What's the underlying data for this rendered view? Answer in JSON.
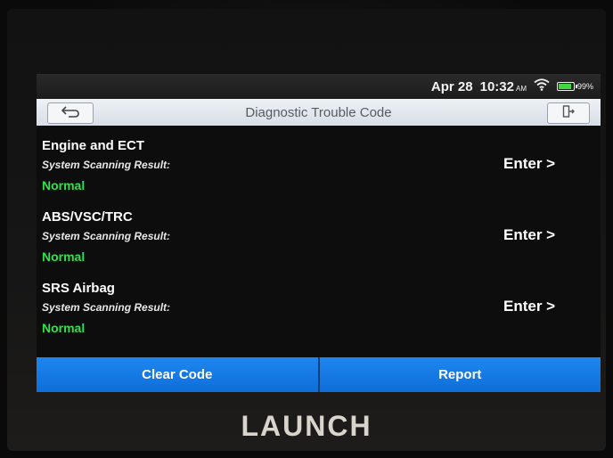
{
  "status_bar": {
    "date": "Apr 28",
    "time": "10:32",
    "ampm": "AM",
    "battery": "99%",
    "battery_level": 0.99
  },
  "header": {
    "title": "Diagnostic Trouble Code"
  },
  "systems": [
    {
      "name": "Engine and ECT",
      "result_label": "System Scanning Result:",
      "result": "Normal",
      "enter_label": "Enter >"
    },
    {
      "name": "ABS/VSC/TRC",
      "result_label": "System Scanning Result:",
      "result": "Normal",
      "enter_label": "Enter >"
    },
    {
      "name": "SRS Airbag",
      "result_label": "System Scanning Result:",
      "result": "Normal",
      "enter_label": "Enter >"
    }
  ],
  "actions": {
    "clear_code": "Clear Code",
    "report": "Report"
  },
  "device": {
    "brand": "LAUNCH"
  },
  "colors": {
    "accent": "#1e86f0",
    "status_ok": "#2fe24a",
    "title_bar": "#e4e9ef"
  },
  "icons": {
    "back": "back-arrow-icon",
    "exit": "exit-door-icon",
    "wifi": "wifi-icon",
    "battery": "battery-icon"
  }
}
